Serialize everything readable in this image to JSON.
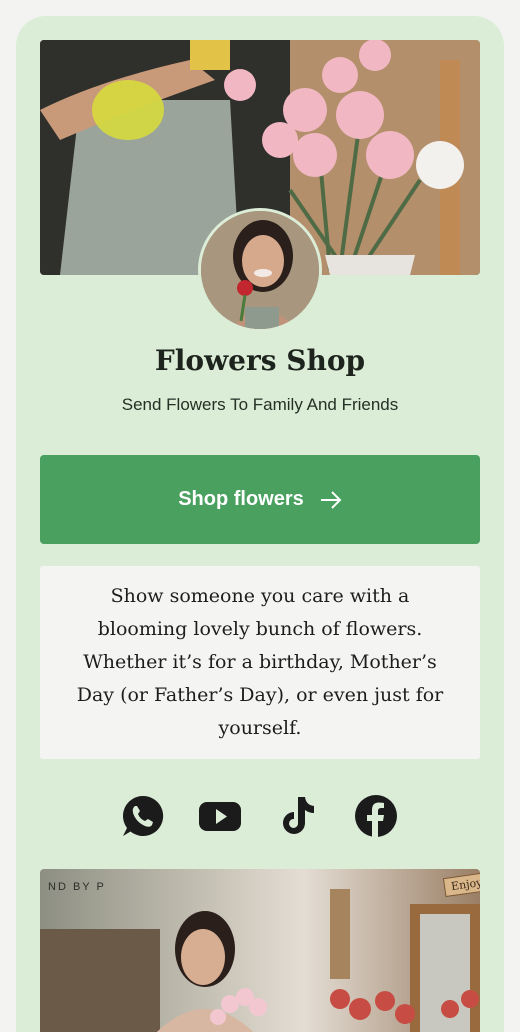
{
  "profile": {
    "title": "Flowers Shop",
    "subtitle": "Send Flowers To Family And Friends"
  },
  "cta": {
    "label": "Shop flowers",
    "icon": "arrow-right-icon"
  },
  "description": "Show someone you care with a blooming lovely bunch of flowers. Whether it’s for a birthday, Mother’s Day (or Father’s Day), or even just for yourself.",
  "socials": [
    {
      "name": "WhatsApp",
      "icon": "whatsapp-icon"
    },
    {
      "name": "YouTube",
      "icon": "youtube-icon"
    },
    {
      "name": "TikTok",
      "icon": "tiktok-icon"
    },
    {
      "name": "Facebook",
      "icon": "facebook-icon"
    }
  ],
  "bottom_photo": {
    "shop_sign": "ND BY P",
    "enjoy_sign": "Enjoy"
  },
  "colors": {
    "background": "#dbecd7",
    "button": "#49a05f",
    "card": "#f4f5f3",
    "icon": "#1b1b1b"
  }
}
